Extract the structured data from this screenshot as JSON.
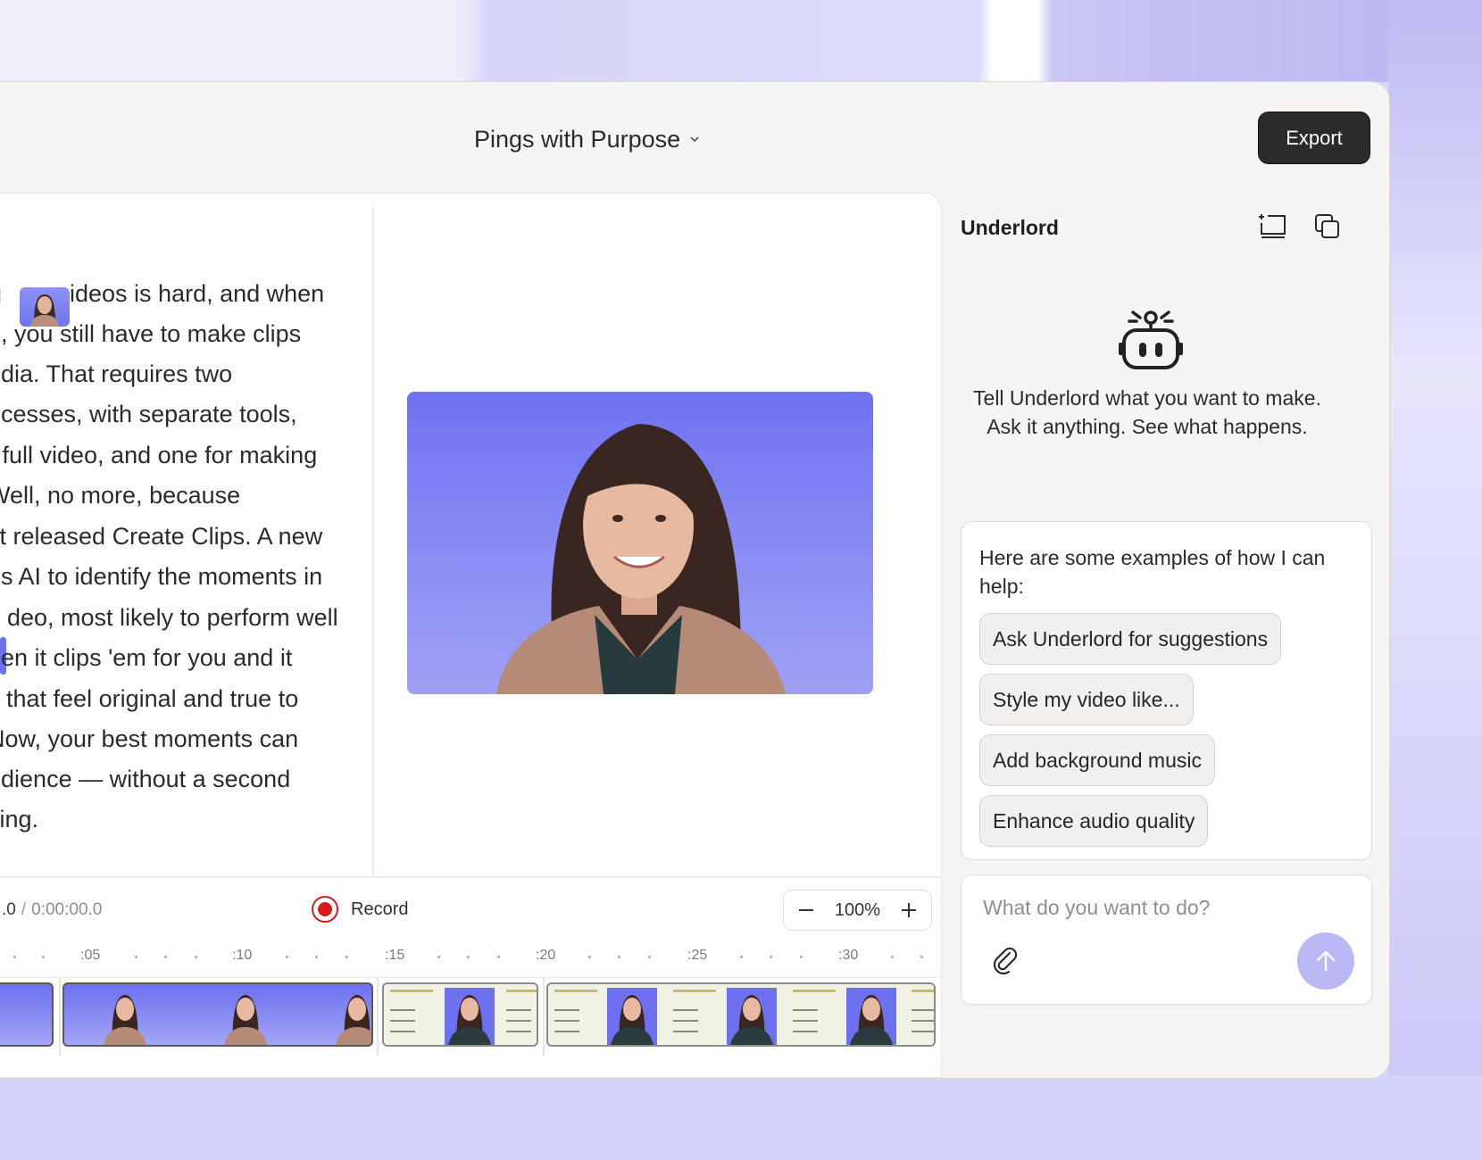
{
  "header": {
    "project_title": "Pings with Purpose",
    "export_label": "Export"
  },
  "transcript": {
    "lines": [
      "g",
      "ideos is hard, and when",
      "e, you still have to make clips",
      "edia. That requires two",
      "ocesses, with separate tools,",
      "r full video, and one for making",
      "Well, no more, because",
      "st released Create Clips. A new",
      "es AI to identify the moments in",
      "deo, most likely to perform well",
      "hen it clips 'em for you and it",
      "s that feel original and true to",
      " Now, your best moments can",
      "udience — without a second",
      "iting."
    ]
  },
  "playback": {
    "current_time": ".0",
    "separator": "/",
    "total_time": "0:00:00.0",
    "record_label": "Record",
    "zoom": "100%"
  },
  "ruler_labels": [
    ":05",
    ":10",
    ":15",
    ":20",
    ":25",
    ":30"
  ],
  "panel": {
    "title": "Underlord",
    "intro": "Tell Underlord what you want to make. Ask it anything. See what happens.",
    "examples_heading": "Here are some examples of how I can help:",
    "suggestions": [
      "Ask Underlord for suggestions",
      "Style my video like...",
      "Add background music",
      "Enhance audio quality"
    ],
    "input_placeholder": "What do you want to do?"
  },
  "colors": {
    "accent": "#6f72f1",
    "record": "#d61c1c",
    "send": "#b9b8f5",
    "export_bg": "#2b2b2b"
  },
  "icons": [
    "chevron-down-icon",
    "new-chat-icon",
    "copy-icon",
    "robot-icon",
    "paperclip-icon",
    "arrow-up-icon",
    "minus-icon",
    "plus-icon",
    "record-icon"
  ]
}
